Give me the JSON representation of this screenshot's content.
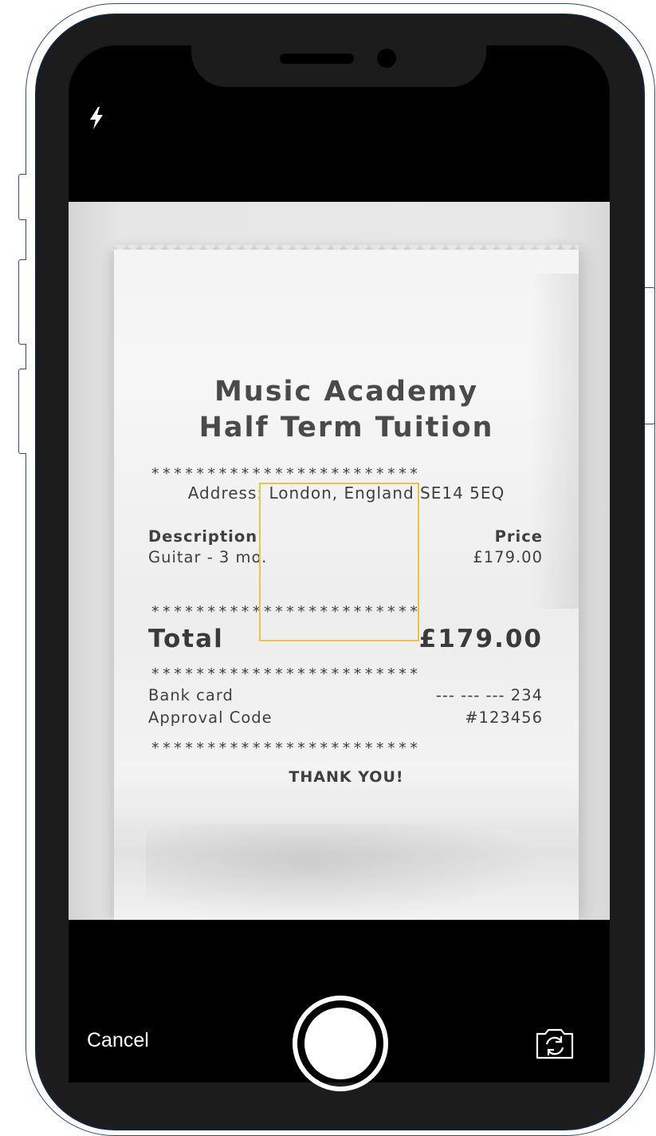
{
  "camera": {
    "flash_icon": "flash-icon",
    "flip_icon": "camera-flip-icon",
    "cancel_label": "Cancel",
    "focus_color": "#e9c34a"
  },
  "receipt": {
    "title_line1": "Music Academy",
    "title_line2": "Half Term Tuition",
    "stars": "************************",
    "address": "Address: London, England SE14 5EQ",
    "description_header": "Description",
    "price_header": "Price",
    "item_name": "Guitar - 3 mo.",
    "item_price": "£179.00",
    "total_label": "Total",
    "total_value": "£179.00",
    "bank_card_label": "Bank card",
    "bank_card_value": "--- --- --- 234",
    "approval_label": "Approval Code",
    "approval_value": "#123456",
    "thank_you": "THANK YOU!"
  }
}
